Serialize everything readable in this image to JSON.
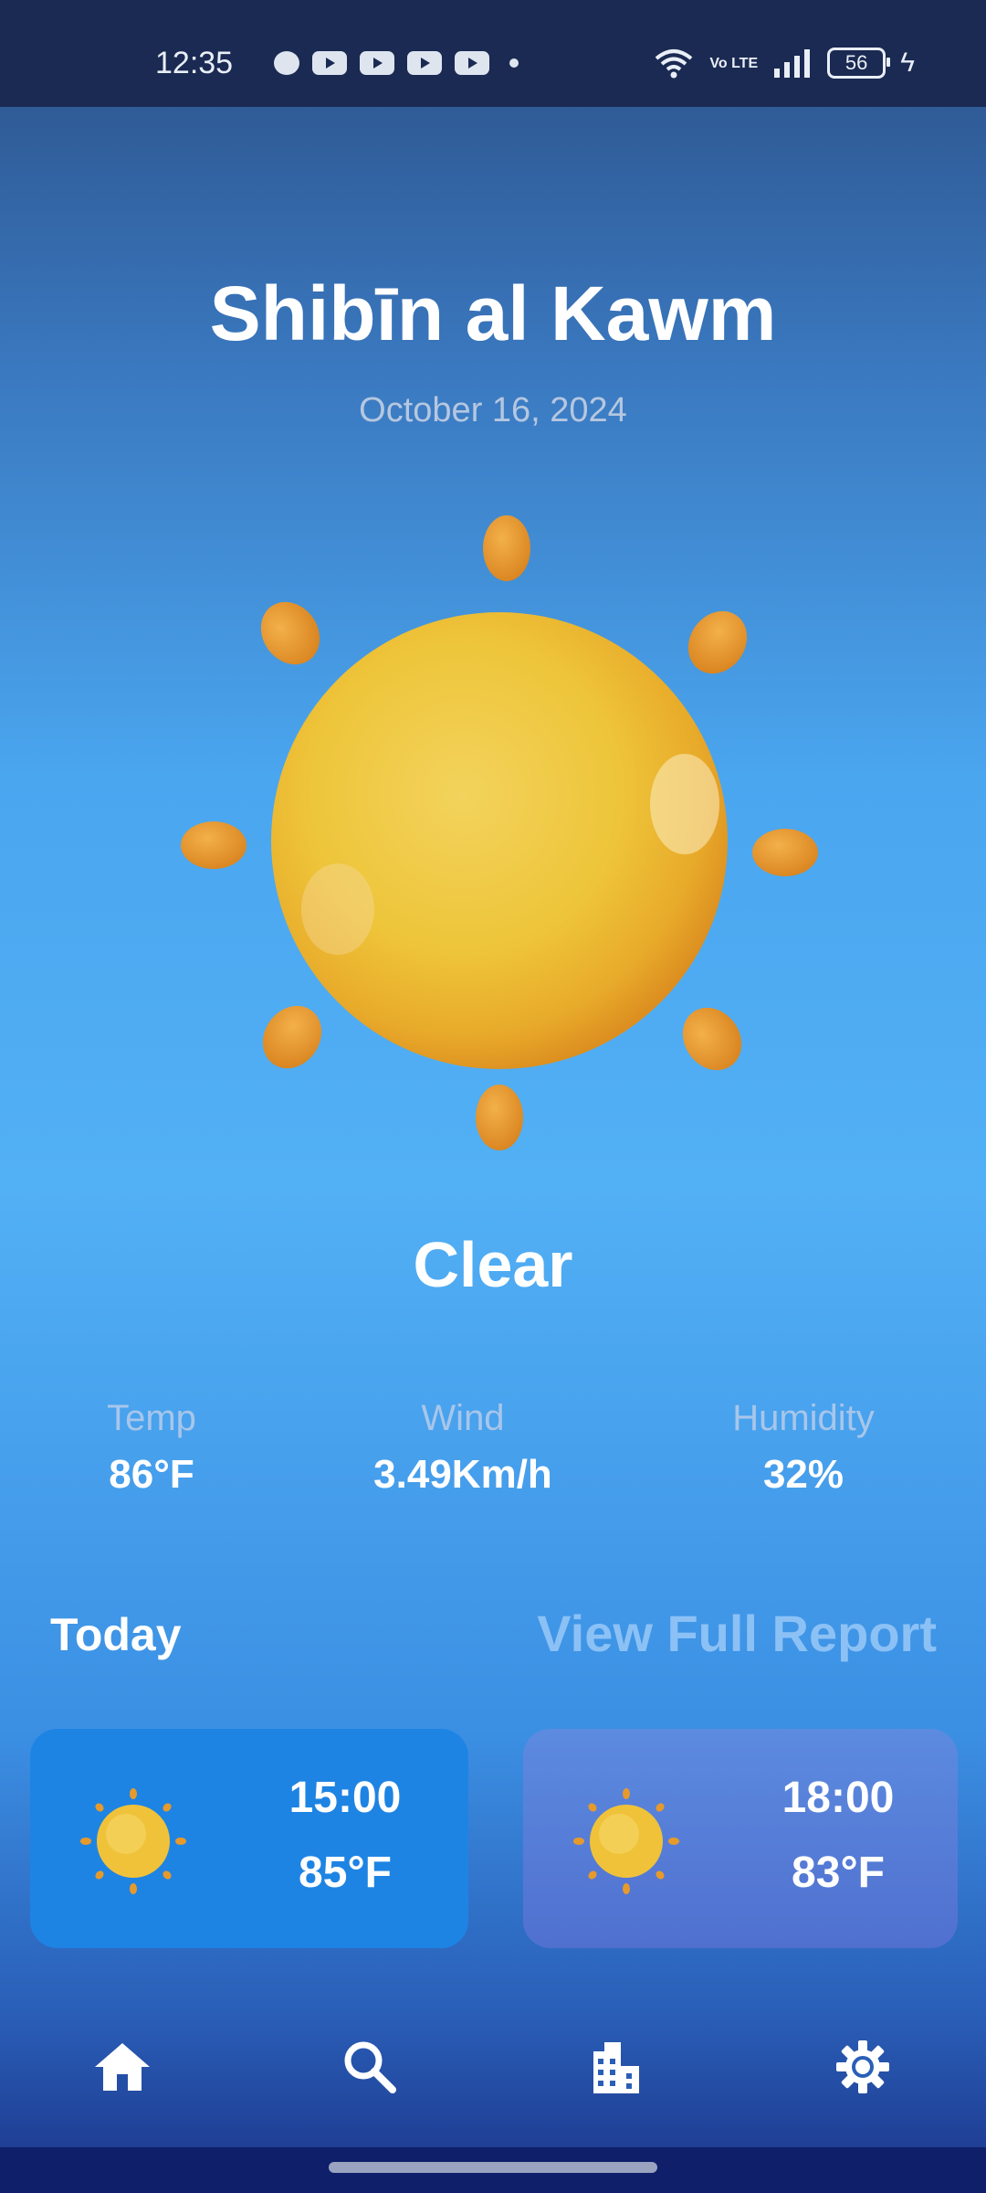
{
  "status_bar": {
    "time": "12:35",
    "battery": "56",
    "network": "Vo LTE"
  },
  "location": {
    "city": "Shibīn al Kawm",
    "date": "October 16, 2024"
  },
  "current": {
    "condition": "Clear",
    "icon": "sun-icon"
  },
  "stats": [
    {
      "label": "Temp",
      "value": "86°F"
    },
    {
      "label": "Wind",
      "value": "3.49Km/h"
    },
    {
      "label": "Humidity",
      "value": "32%"
    }
  ],
  "forecast_header": {
    "title": "Today",
    "link": "View Full Report"
  },
  "hourly": [
    {
      "time": "15:00",
      "temp": "85°F",
      "icon": "sun-icon"
    },
    {
      "time": "18:00",
      "temp": "83°F",
      "icon": "sun-icon"
    }
  ],
  "nav": [
    {
      "name": "home",
      "icon": "home-icon"
    },
    {
      "name": "search",
      "icon": "search-icon"
    },
    {
      "name": "cities",
      "icon": "city-icon"
    },
    {
      "name": "settings",
      "icon": "gear-icon"
    }
  ],
  "colors": {
    "accent": "#1e84e3",
    "card_secondary": "#5a80d9",
    "sun": "#f0c23a",
    "sun_ray": "#e69a2c",
    "link": "#8cc1f5"
  }
}
